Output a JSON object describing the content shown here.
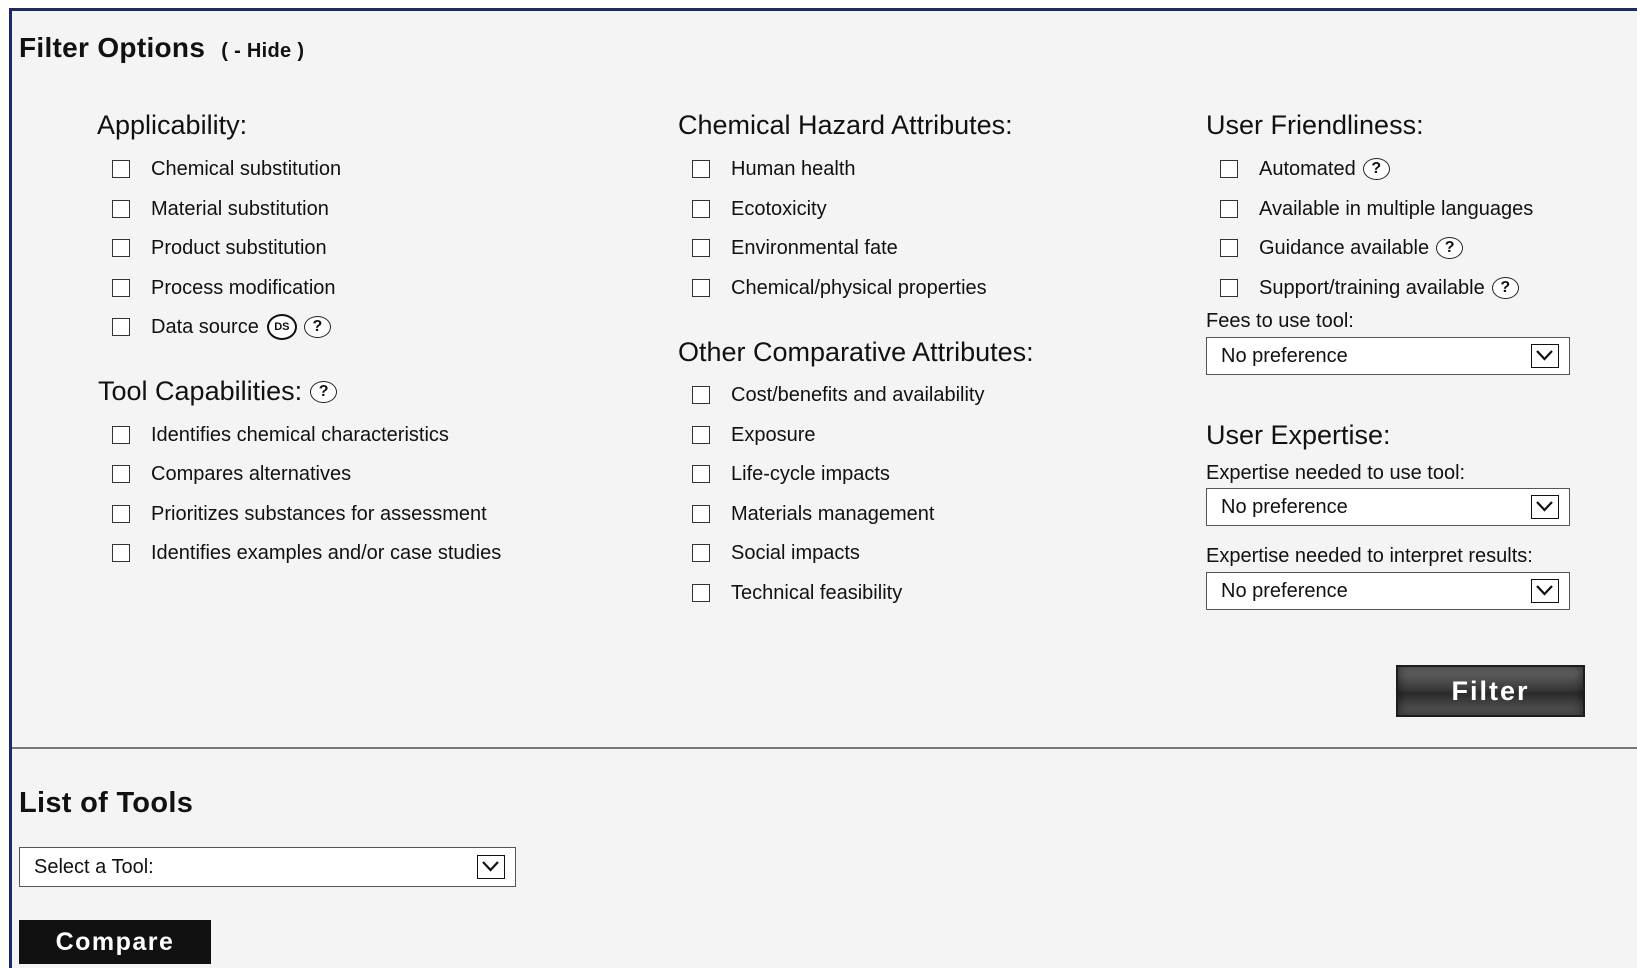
{
  "filter": {
    "title": "Filter Options",
    "hide_label": "( - Hide )",
    "button_label": "Filter"
  },
  "applicability": {
    "heading": "Applicability:",
    "items": [
      "Chemical substitution",
      "Material substitution",
      "Product substitution",
      "Process modification",
      "Data source"
    ],
    "ds_badge": "DS"
  },
  "tool_capabilities": {
    "heading": "Tool Capabilities:",
    "items": [
      "Identifies chemical characteristics",
      "Compares alternatives",
      "Prioritizes substances for assessment",
      "Identifies examples and/or case studies"
    ]
  },
  "chemical_hazard": {
    "heading": "Chemical Hazard Attributes:",
    "items": [
      "Human health",
      "Ecotoxicity",
      "Environmental fate",
      "Chemical/physical properties"
    ]
  },
  "other_comparative": {
    "heading": "Other Comparative Attributes:",
    "items": [
      "Cost/benefits and availability",
      "Exposure",
      "Life-cycle impacts",
      "Materials management",
      "Social impacts",
      "Technical feasibility"
    ]
  },
  "user_friendliness": {
    "heading": "User Friendliness:",
    "items": [
      "Automated",
      "Available in multiple languages",
      "Guidance available",
      "Support/training available"
    ],
    "fees_label": "Fees to use tool:",
    "fees_value": "No preference"
  },
  "user_expertise": {
    "heading": "User Expertise:",
    "use_label": "Expertise needed to use tool:",
    "use_value": "No preference",
    "interpret_label": "Expertise needed to interpret results:",
    "interpret_value": "No preference"
  },
  "list_of_tools": {
    "title": "List of Tools",
    "select_value": "Select a Tool:",
    "compare_label": "Compare"
  },
  "icons": {
    "help": "question-circle-icon",
    "help_glyph": "?",
    "dropdown": "chevron-down-icon",
    "data_source": "ds-badge-icon"
  },
  "colors": {
    "frame_border": "#1c2a66",
    "panel_bg": "#f4f4f4",
    "button_dark": "#111111"
  }
}
